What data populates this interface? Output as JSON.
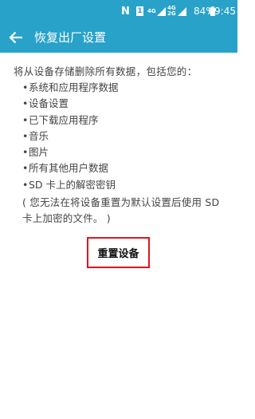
{
  "status_bar": {
    "nfc": "N",
    "sim": "1",
    "net1": "4G",
    "net2_top": "4G",
    "net2_bottom": "2G",
    "battery": "84%",
    "time": "09:45"
  },
  "app_bar": {
    "title": "恢复出厂设置",
    "back_icon": "arrow-back-icon"
  },
  "content": {
    "intro": "将从设备存储删除所有数据，包括您的：",
    "items": [
      "系统和应用程序数据",
      "设备设置",
      "已下载应用程序",
      "音乐",
      "图片",
      "所有其他用户数据",
      "SD 卡上的解密密钥"
    ],
    "bullet": "•",
    "note": "( 您无法在将设备重置为默认设置后使用 SD 卡上加密的文件。 )"
  },
  "actions": {
    "reset_label": "重置设备",
    "reset_border_color": "#e0141e"
  },
  "colors": {
    "app_bar": "#28a2c9",
    "text": "#444444"
  }
}
